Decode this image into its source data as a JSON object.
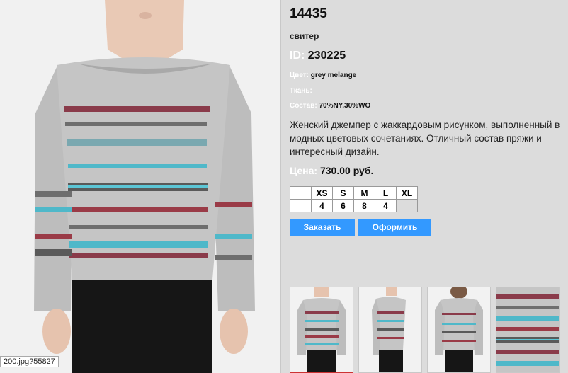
{
  "product": {
    "title": "14435",
    "subtitle": "свитер",
    "id_label": "ID:",
    "id_value": "230225",
    "color_label": "Цвет:",
    "color_value": "grey melange",
    "fabric_label": "Ткань:",
    "fabric_value": "",
    "composition_label": "Состав:",
    "composition_value": "70%NY,30%WO",
    "description": "Женский джемпер с жаккардовым рисунком, выполненный в модных цветовых сочетаниях. Отличный состав пряжи и интересный дизайн.",
    "price_label": "Цена:",
    "price_value": "730.00 руб."
  },
  "sizes": {
    "headers": [
      "XS",
      "S",
      "M",
      "L",
      "XL"
    ],
    "quantities": [
      "4",
      "6",
      "8",
      "4",
      ""
    ]
  },
  "buttons": {
    "order": "Заказать",
    "checkout": "Оформить"
  },
  "status_tip": "200.jpg?55827",
  "colors": {
    "accent_button": "#3399ff",
    "label_white": "#ffffff",
    "panel_bg": "#dcdcdc",
    "active_thumb_border": "#cc3333"
  }
}
